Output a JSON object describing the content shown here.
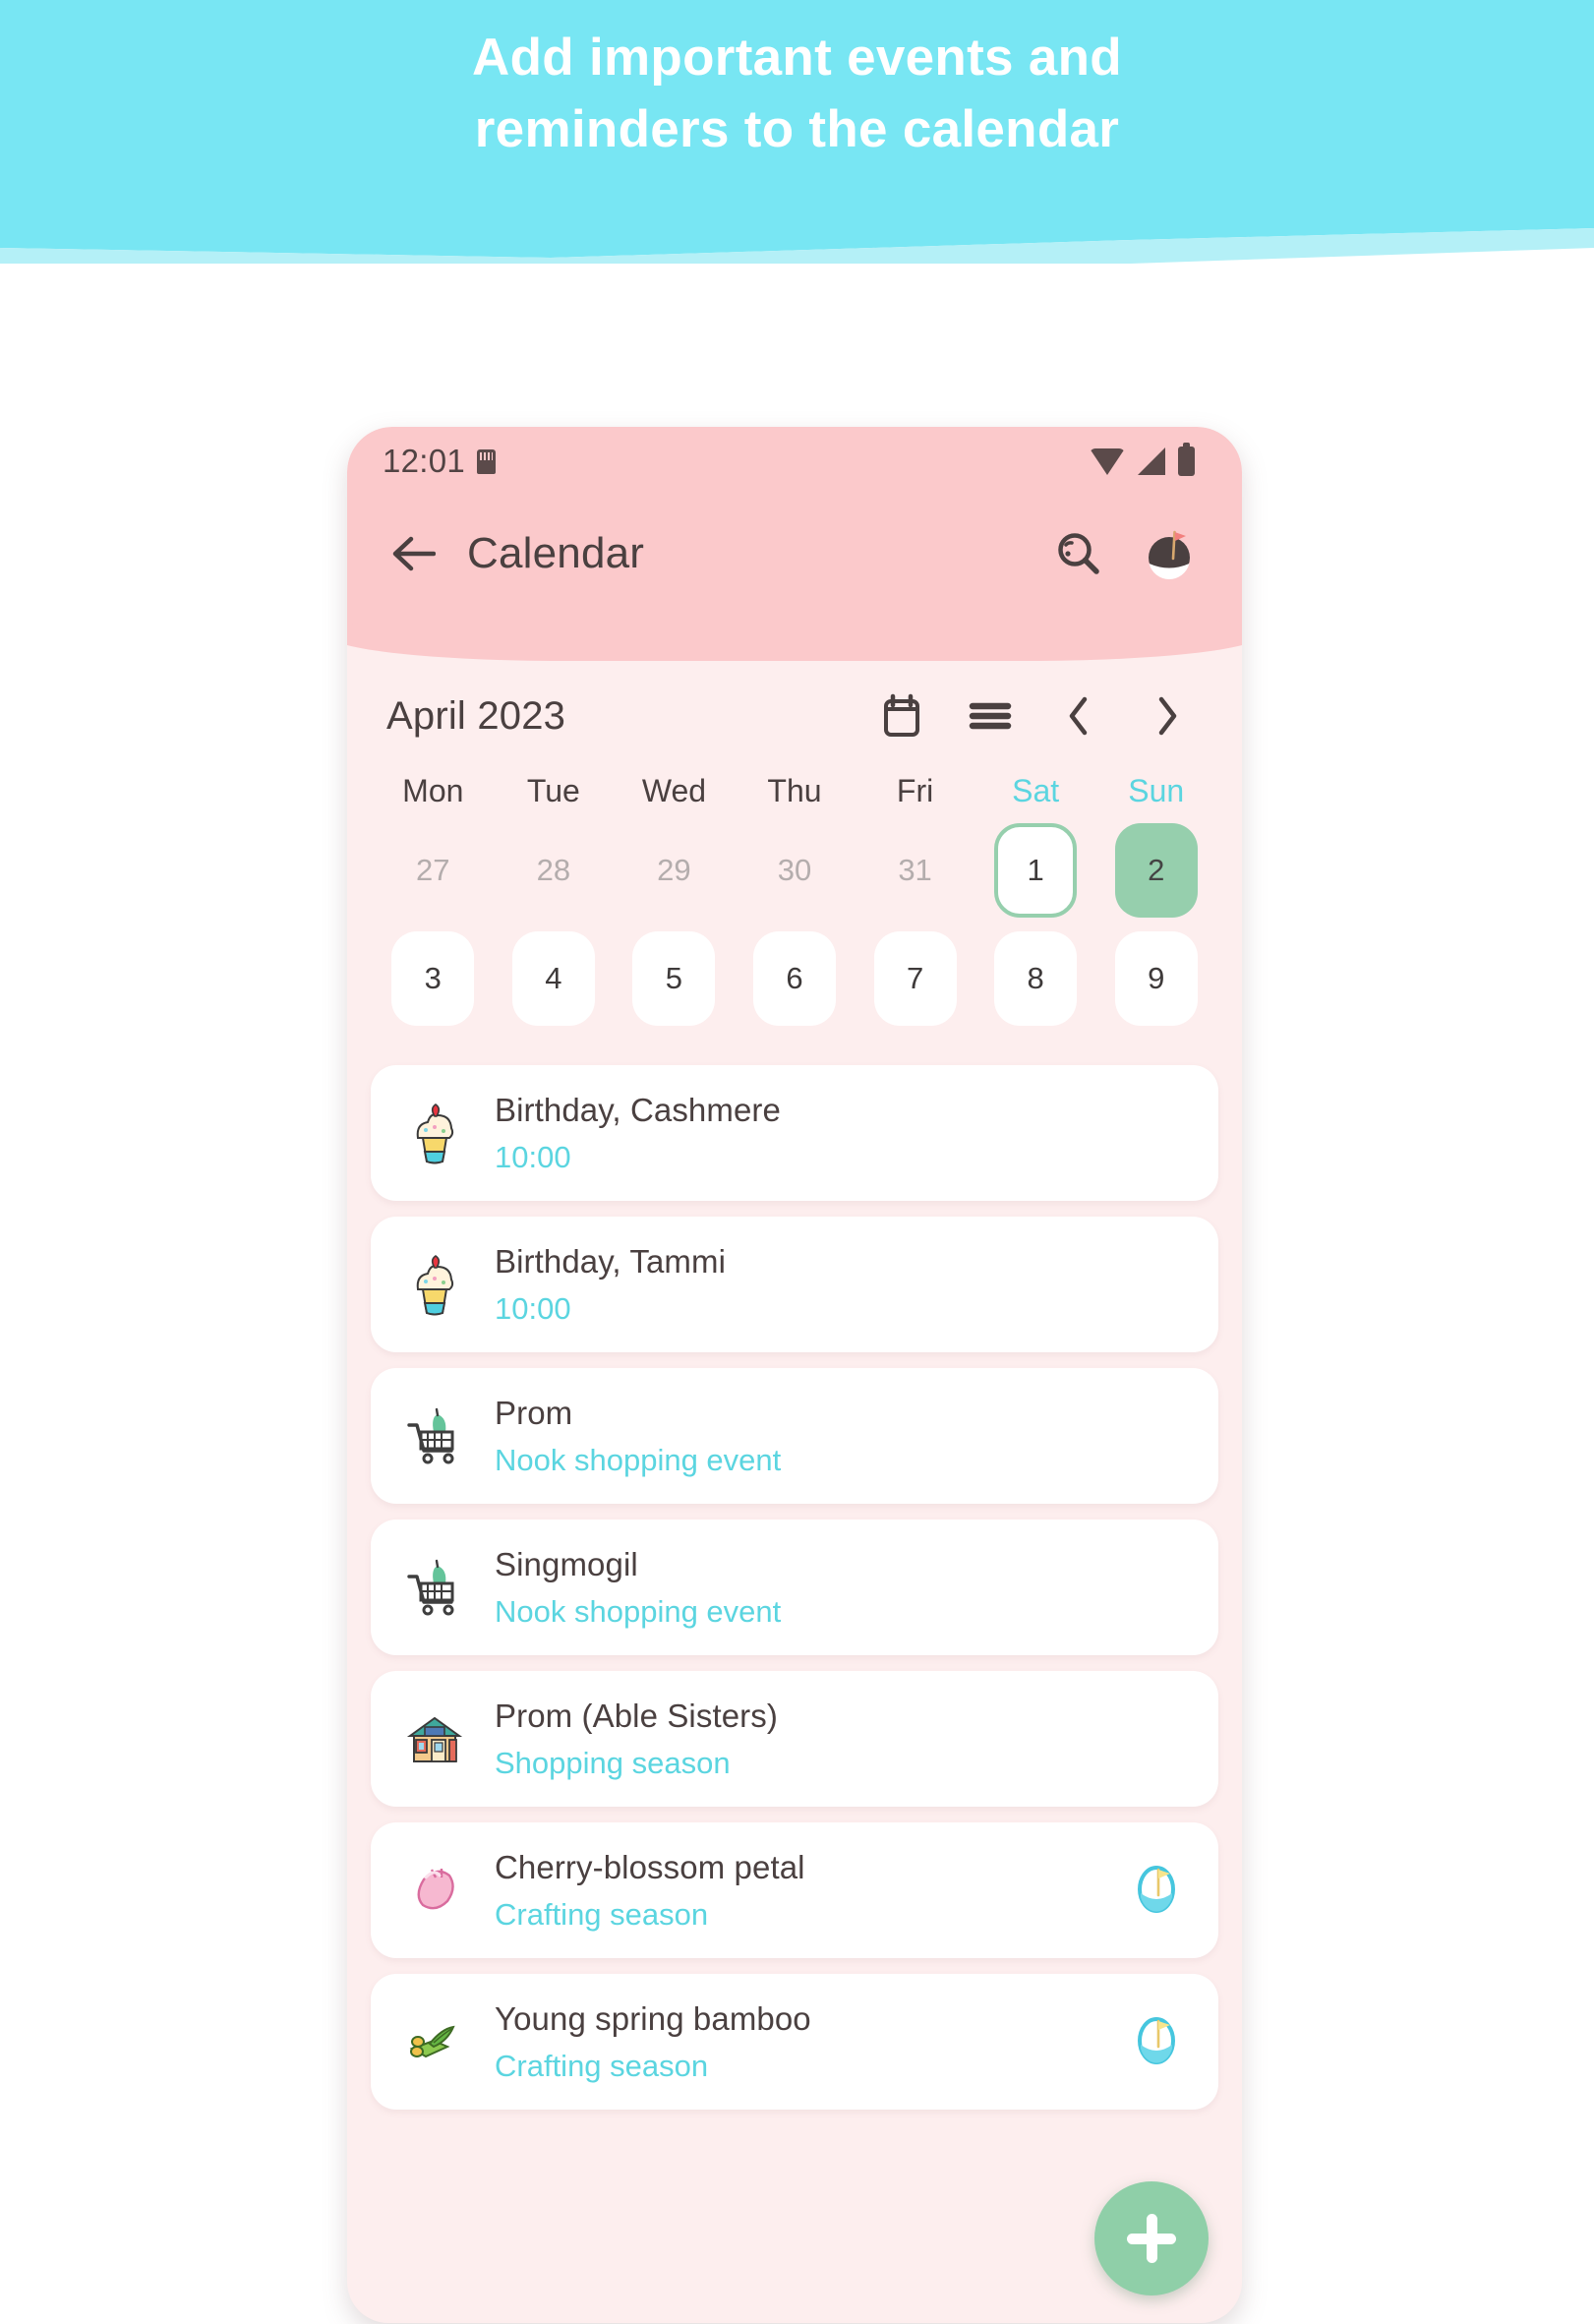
{
  "banner": {
    "line1": "Add important events and",
    "line2": "reminders to the calendar",
    "bg_color": "#78E6F3",
    "text_color": "#FFFFFF"
  },
  "status_bar": {
    "time": "12:01",
    "icons": [
      "sd-card-icon",
      "wifi-icon",
      "signal-icon",
      "battery-icon"
    ]
  },
  "app_bar": {
    "back_icon": "arrow-left-icon",
    "title": "Calendar",
    "search_icon": "search-icon",
    "profile_icon": "island-flag-icon",
    "bg_color": "#FBC9CB"
  },
  "calendar": {
    "month_label": "April 2023",
    "tools": [
      {
        "name": "calendar-view-icon",
        "label": "calendar"
      },
      {
        "name": "list-view-icon",
        "label": "list"
      },
      {
        "name": "chevron-left-icon",
        "label": "previous"
      },
      {
        "name": "chevron-right-icon",
        "label": "next"
      }
    ],
    "weekdays": [
      {
        "label": "Mon",
        "weekend": false
      },
      {
        "label": "Tue",
        "weekend": false
      },
      {
        "label": "Wed",
        "weekend": false
      },
      {
        "label": "Thu",
        "weekend": false
      },
      {
        "label": "Fri",
        "weekend": false
      },
      {
        "label": "Sat",
        "weekend": true
      },
      {
        "label": "Sun",
        "weekend": true
      }
    ],
    "week1": [
      {
        "day": "27",
        "state": "muted"
      },
      {
        "day": "28",
        "state": "muted"
      },
      {
        "day": "29",
        "state": "muted"
      },
      {
        "day": "30",
        "state": "muted"
      },
      {
        "day": "31",
        "state": "muted"
      },
      {
        "day": "1",
        "state": "today"
      },
      {
        "day": "2",
        "state": "selected"
      }
    ],
    "week2": [
      {
        "day": "3",
        "state": "plain"
      },
      {
        "day": "4",
        "state": "plain"
      },
      {
        "day": "5",
        "state": "plain"
      },
      {
        "day": "6",
        "state": "plain"
      },
      {
        "day": "7",
        "state": "plain"
      },
      {
        "day": "8",
        "state": "plain"
      },
      {
        "day": "9",
        "state": "plain"
      }
    ],
    "today_color": "#96CFAD",
    "selected_color": "#96CFAD",
    "accent_color": "#5BD5E0"
  },
  "events": [
    {
      "title": "Birthday, Cashmere",
      "subtitle": "10:00",
      "icon": "cupcake-icon",
      "badge": null
    },
    {
      "title": "Birthday, Tammi",
      "subtitle": "10:00",
      "icon": "cupcake-icon",
      "badge": null
    },
    {
      "title": "Prom",
      "subtitle": "Nook shopping event",
      "icon": "shopping-cart-icon",
      "badge": null
    },
    {
      "title": "Singmogil",
      "subtitle": "Nook shopping event",
      "icon": "shopping-cart-icon",
      "badge": null
    },
    {
      "title": "Prom (Able Sisters)",
      "subtitle": "Shopping season",
      "icon": "shop-house-icon",
      "badge": null
    },
    {
      "title": "Cherry-blossom petal",
      "subtitle": "Crafting season",
      "icon": "cherry-blossom-petal-icon",
      "badge": "season-timer-icon"
    },
    {
      "title": "Young spring bamboo",
      "subtitle": "Crafting season",
      "icon": "bamboo-icon",
      "badge": "season-timer-icon"
    }
  ],
  "fab": {
    "icon": "plus-icon",
    "color": "#8FCFA8"
  }
}
